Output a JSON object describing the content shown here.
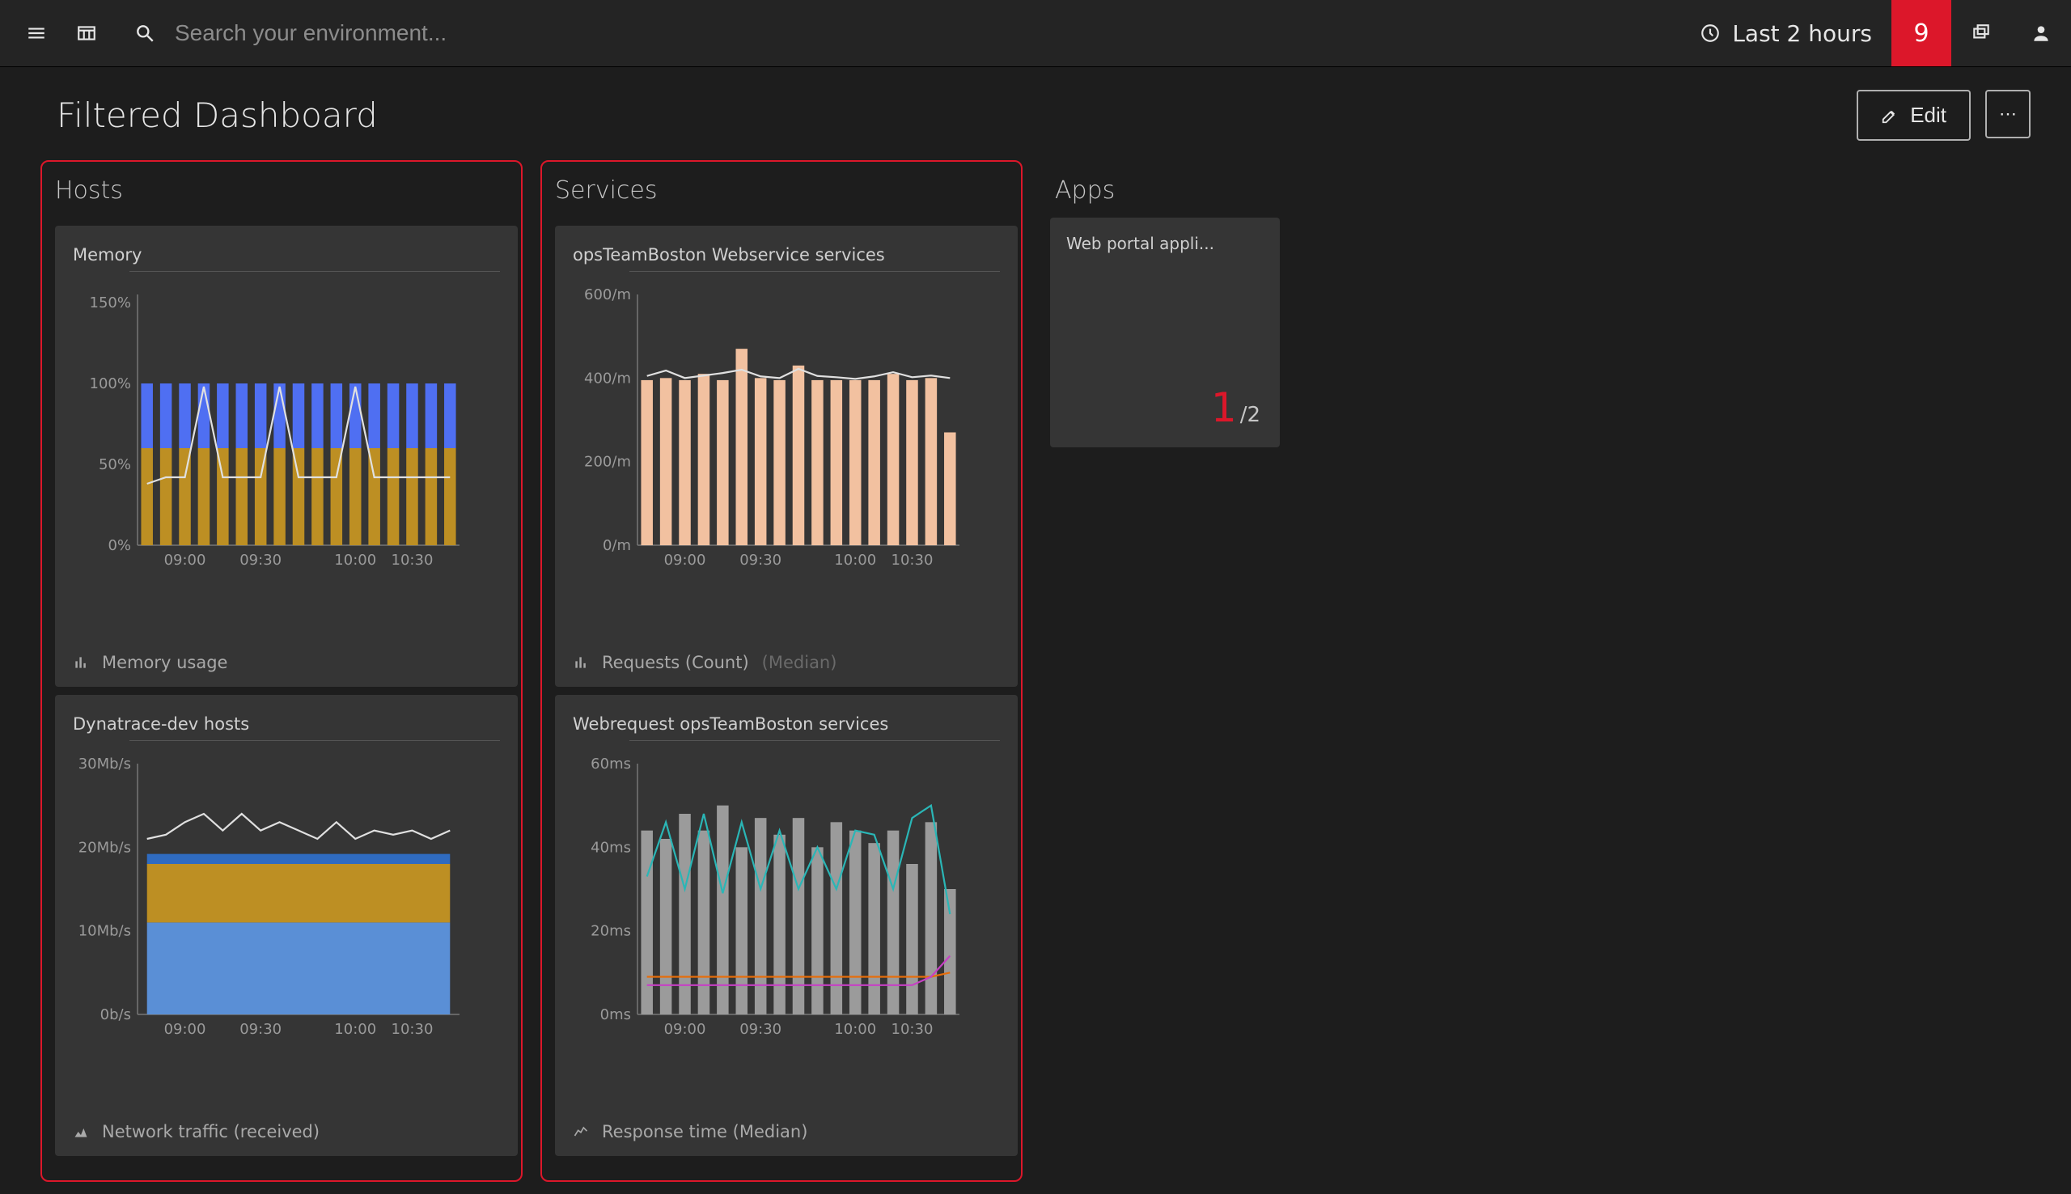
{
  "topbar": {
    "search_placeholder": "Search your environment...",
    "time_label": "Last 2 hours",
    "problems_badge": "9"
  },
  "page": {
    "title": "Filtered Dashboard",
    "edit_label": "Edit",
    "more_label": "⋯"
  },
  "sections": {
    "hosts": {
      "title": "Hosts"
    },
    "services": {
      "title": "Services"
    },
    "apps": {
      "title": "Apps"
    }
  },
  "hosts_memory": {
    "title": "Memory",
    "legend": "Memory usage"
  },
  "hosts_network": {
    "title": "Dynatrace-dev hosts",
    "legend": "Network traffic (received)"
  },
  "svc_requests": {
    "title": "opsTeamBoston Webservice services",
    "legend": "Requests (Count)",
    "legend_faint": "(Median)"
  },
  "svc_response": {
    "title": "Webrequest opsTeamBoston services",
    "legend": "Response time (Median)"
  },
  "app_tile": {
    "title": "Web portal appli...",
    "bad": "1",
    "total": "/2"
  },
  "chart_data": [
    {
      "id": "hosts_memory",
      "type": "bar+line",
      "title": "Memory",
      "ylabel_suffix": "%",
      "yticks": [
        0,
        50,
        100,
        150
      ],
      "ylim": [
        0,
        155
      ],
      "xticks": [
        "09:00",
        "09:30",
        "10:00",
        "10:30"
      ],
      "n_bars": 17,
      "stacked_series": [
        {
          "name": "series-lower",
          "color": "#bd8f23",
          "values": [
            60,
            60,
            60,
            60,
            60,
            60,
            60,
            60,
            60,
            60,
            60,
            60,
            60,
            60,
            60,
            60,
            60
          ]
        },
        {
          "name": "series-upper",
          "color": "#4f6ff2",
          "values": [
            40,
            40,
            40,
            40,
            40,
            40,
            40,
            40,
            40,
            40,
            40,
            40,
            40,
            40,
            40,
            40,
            40
          ]
        }
      ],
      "line_series": [
        {
          "name": "line",
          "color": "#e0e0e0",
          "values": [
            38,
            42,
            42,
            98,
            42,
            42,
            42,
            98,
            42,
            42,
            42,
            98,
            42,
            42,
            42,
            42,
            42
          ]
        }
      ]
    },
    {
      "id": "hosts_network",
      "type": "area+line",
      "title": "Dynatrace-dev hosts",
      "ylabel_suffix": "",
      "ytick_labels": [
        "0b/s",
        "10Mb/s",
        "20Mb/s",
        "30Mb/s"
      ],
      "ytick_values": [
        0,
        10,
        20,
        30
      ],
      "ylim": [
        0,
        30
      ],
      "xticks": [
        "09:00",
        "09:30",
        "10:00",
        "10:30"
      ],
      "n": 17,
      "area_series": [
        {
          "name": "area-bottom",
          "color": "#5a8fd6",
          "values": [
            11,
            11,
            11,
            11,
            11,
            11,
            11,
            11,
            11,
            11,
            11,
            11,
            11,
            11,
            11,
            11,
            11
          ]
        },
        {
          "name": "area-mid",
          "color": "#bd8f23",
          "values": [
            7,
            7,
            7,
            7,
            7,
            7,
            7,
            7,
            7,
            7,
            7,
            7,
            7,
            7,
            7,
            7,
            7
          ]
        },
        {
          "name": "area-top",
          "color": "#2f6bc0",
          "values": [
            1.2,
            1.2,
            1.2,
            1.2,
            1.2,
            1.2,
            1.2,
            1.2,
            1.2,
            1.2,
            1.2,
            1.2,
            1.2,
            1.2,
            1.2,
            1.2,
            1.2
          ]
        }
      ],
      "line_series": [
        {
          "name": "line",
          "color": "#e0e0e0",
          "values": [
            21,
            21.5,
            23,
            24,
            22,
            24,
            22,
            23,
            22,
            21,
            23,
            21,
            22,
            21.5,
            22,
            21,
            22
          ]
        }
      ]
    },
    {
      "id": "svc_requests",
      "type": "bar+line",
      "title": "opsTeamBoston Webservice services",
      "ylabel_suffix": "/m",
      "ytick_labels": [
        "0/m",
        "200/m",
        "400/m",
        "600/m"
      ],
      "ytick_values": [
        0,
        200,
        400,
        600
      ],
      "ylim": [
        0,
        600
      ],
      "xticks": [
        "09:00",
        "09:30",
        "10:00",
        "10:30"
      ],
      "n_bars": 17,
      "bar_series": [
        {
          "name": "requests",
          "color": "#f2c1a0",
          "values": [
            395,
            400,
            395,
            410,
            395,
            470,
            400,
            395,
            430,
            395,
            395,
            395,
            395,
            410,
            395,
            400,
            270
          ]
        }
      ],
      "line_series": [
        {
          "name": "median",
          "color": "#e0e0e0",
          "values": [
            405,
            418,
            400,
            406,
            412,
            420,
            404,
            400,
            422,
            405,
            402,
            398,
            404,
            414,
            402,
            406,
            400
          ]
        }
      ]
    },
    {
      "id": "svc_response",
      "type": "bar+lines",
      "title": "Webrequest opsTeamBoston services",
      "ylabel_suffix": "ms",
      "ytick_labels": [
        "0ms",
        "20ms",
        "40ms",
        "60ms"
      ],
      "ytick_values": [
        0,
        20,
        40,
        60
      ],
      "ylim": [
        0,
        60
      ],
      "xticks": [
        "09:00",
        "09:30",
        "10:00",
        "10:30"
      ],
      "n_bars": 17,
      "bar_series": [
        {
          "name": "count",
          "color": "#9b9b9b",
          "values": [
            44,
            42,
            48,
            44,
            50,
            40,
            47,
            43,
            47,
            40,
            46,
            44,
            41,
            44,
            36,
            46,
            30
          ]
        }
      ],
      "line_series": [
        {
          "name": "teal",
          "color": "#2ab6b6",
          "values": [
            33,
            46,
            30,
            48,
            29,
            46,
            30,
            44,
            30,
            40,
            30,
            44,
            43,
            30,
            47,
            50,
            24
          ]
        },
        {
          "name": "orange",
          "color": "#e66d0a",
          "values": [
            9,
            9,
            9,
            9,
            9,
            9,
            9,
            9,
            9,
            9,
            9,
            9,
            9,
            9,
            9,
            9,
            10
          ]
        },
        {
          "name": "magenta",
          "color": "#c740c5",
          "values": [
            7,
            7,
            7,
            7,
            7,
            7,
            7,
            7,
            7,
            7,
            7,
            7,
            7,
            7,
            7,
            9,
            14
          ]
        }
      ]
    }
  ]
}
